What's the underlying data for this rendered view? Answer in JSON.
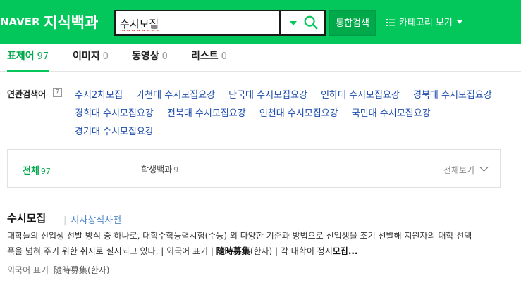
{
  "header": {
    "naver_logo": "NAVER",
    "service_name": "지식백과",
    "search_value": "수시모집",
    "total_search_label": "통합검색",
    "category_label": "카테고리 보기"
  },
  "tabs": [
    {
      "label": "표제어",
      "count": "97"
    },
    {
      "label": "이미지",
      "count": "0"
    },
    {
      "label": "동영상",
      "count": "0"
    },
    {
      "label": "리스트",
      "count": "0"
    }
  ],
  "related": {
    "label": "연관검색어",
    "help": "?",
    "links": [
      "수시2차모집",
      "가천대 수시모집요강",
      "단국대 수시모집요강",
      "인하대 수시모집요강",
      "경북대 수시모집요강",
      "경희대 수시모집요강",
      "전북대 수시모집요강",
      "인천대 수시모집요강",
      "국민대 수시모집요강",
      "경기대 수시모집요강"
    ]
  },
  "filter": {
    "all_label": "전체",
    "all_count": "97",
    "student_label": "학생백과",
    "student_count": "9",
    "more_label": "전체보기"
  },
  "result": {
    "title": "수시모집",
    "source": "시사상식사전",
    "desc_main": "대학들의 신입생 선발 방식 중 하나로, 대학수학능력시험(수능) 외 다양한 기준과 방법으로 신입생을 조기 선발해 지원자의 대학 선택 폭을 넓혀 주기 위한 취지로 실시되고 있다. | 외국어 표기 | ",
    "desc_bold1": "隨時募集",
    "desc_mid": "(한자) | 각 대학이 정시",
    "desc_bold2": "모집...",
    "meta_label": "외국어 표기",
    "meta_hanja": "隨時募集(한자)"
  },
  "colors": {
    "brand_green": "#03c75a",
    "link_blue": "#1a4bab"
  }
}
